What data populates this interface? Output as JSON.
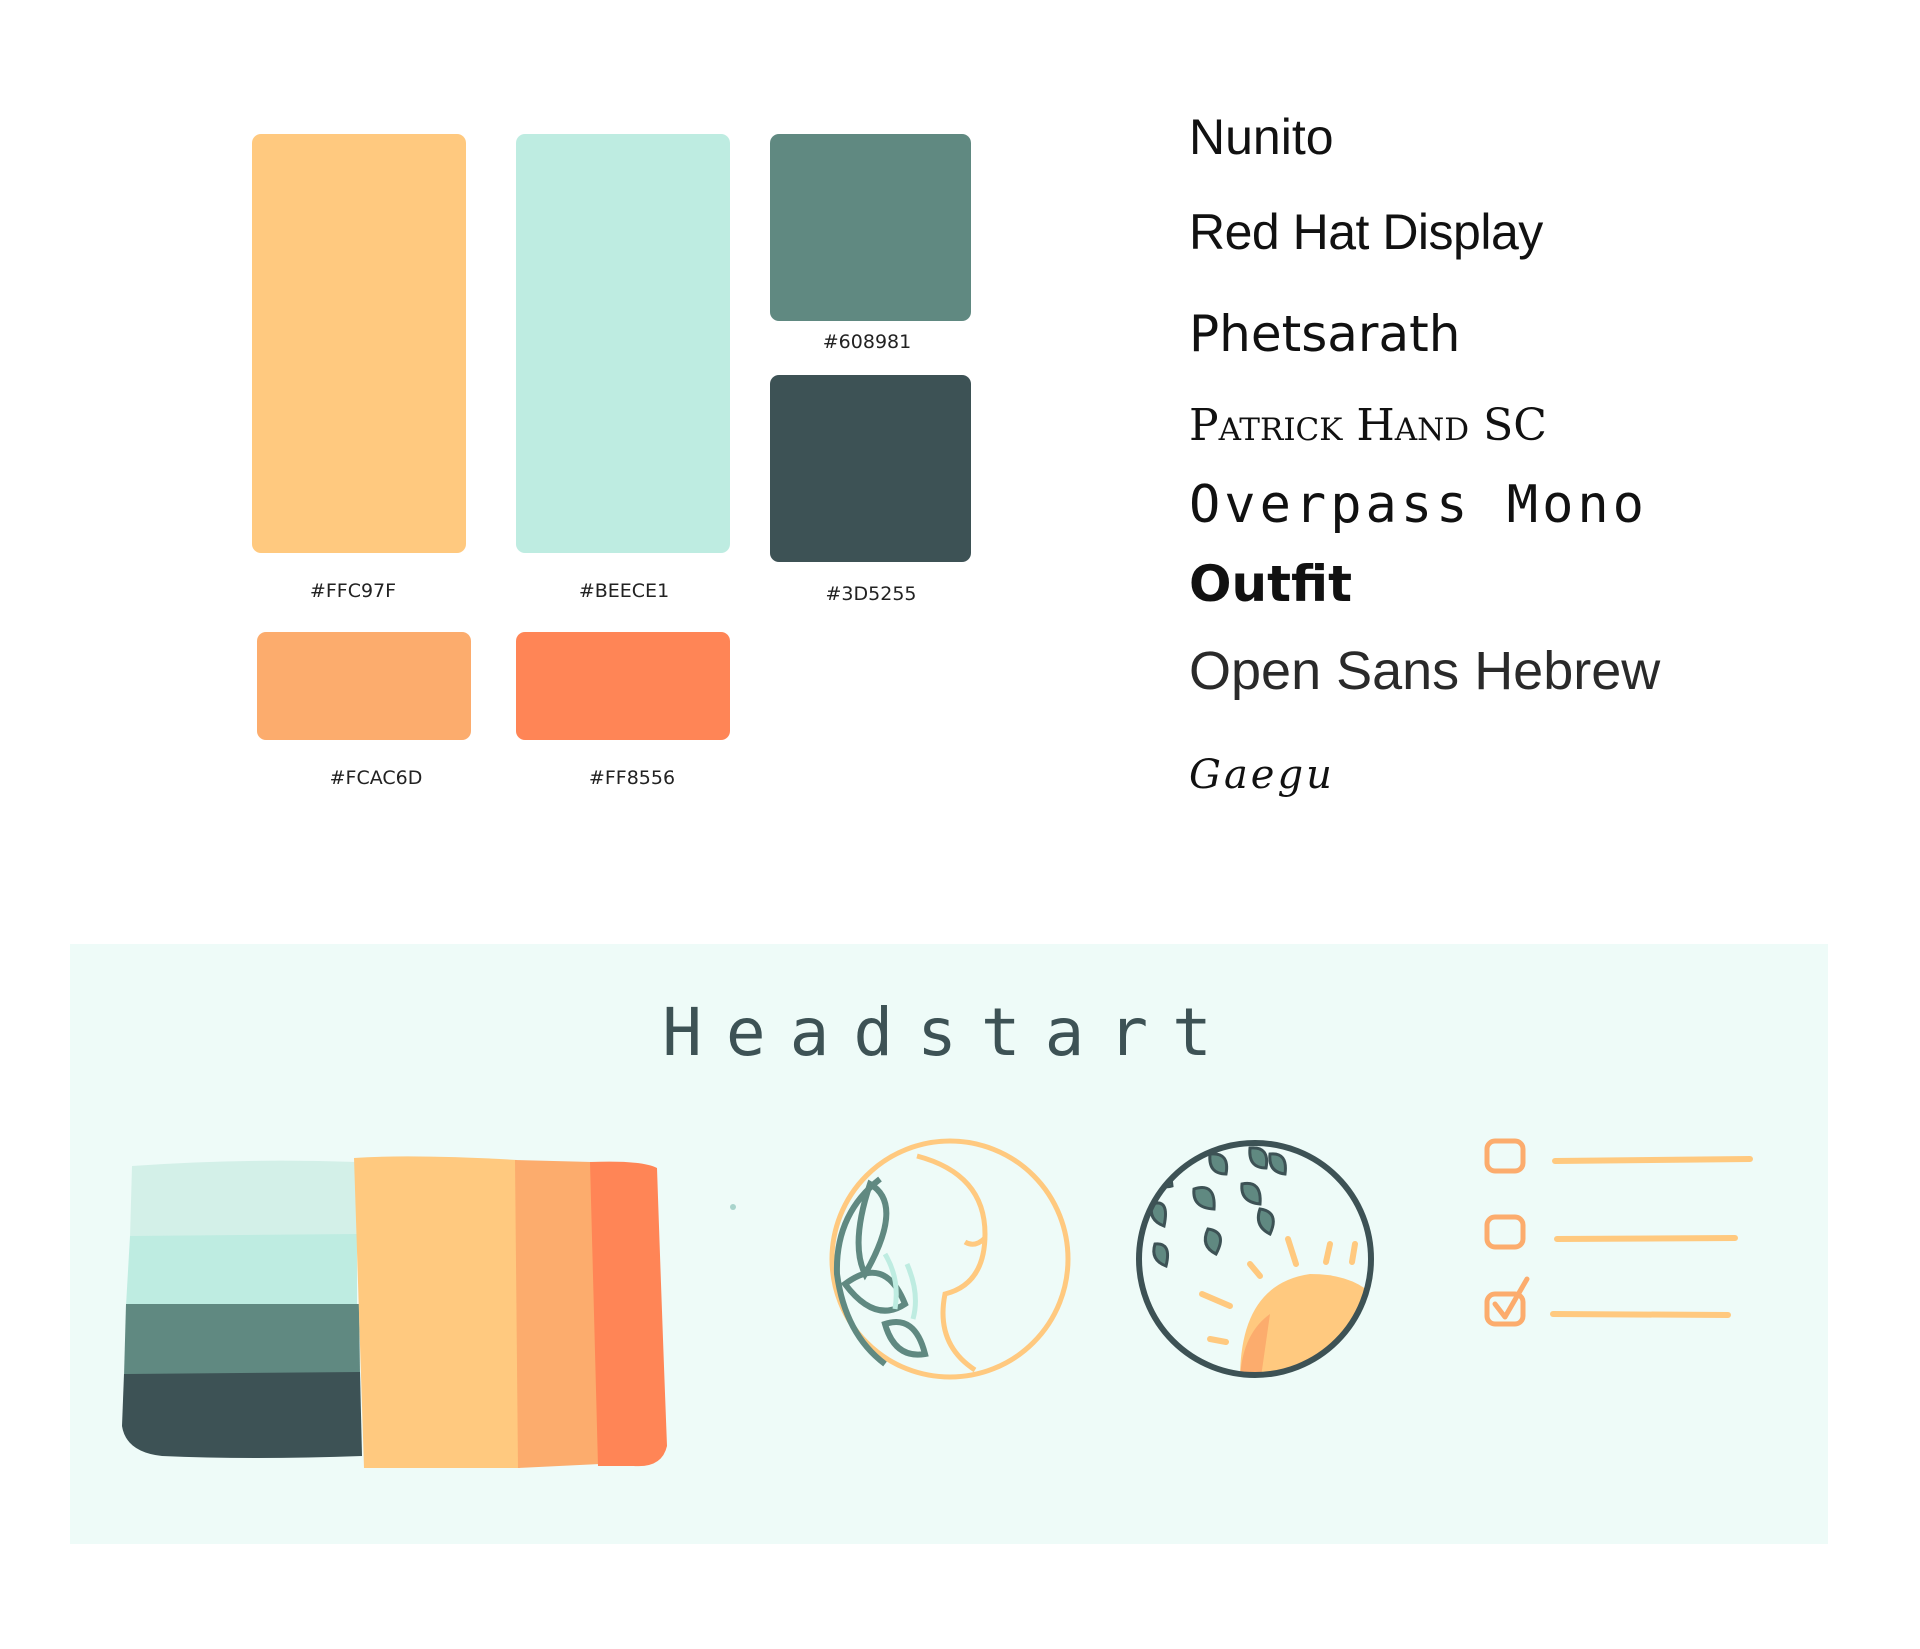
{
  "palette": {
    "swatches": [
      {
        "name": "yellow",
        "hex": "#FFC97F",
        "label": "#FFC97F"
      },
      {
        "name": "mint",
        "hex": "#BEECE1",
        "label": "#BEECE1"
      },
      {
        "name": "sage",
        "hex": "#608981",
        "label": "#608981"
      },
      {
        "name": "slate",
        "hex": "#3D5255",
        "label": "#3D5255"
      },
      {
        "name": "peach",
        "hex": "#FCAC6D",
        "label": "#FCAC6D"
      },
      {
        "name": "coral",
        "hex": "#FF8556",
        "label": "#FF8556"
      }
    ]
  },
  "fonts": {
    "names": [
      "Nunito",
      "Red Hat Display",
      "Phetsarath",
      "Patrick Hand SC",
      "Overpass Mono",
      "Outfit",
      "Open Sans Hebrew",
      "Gaegu"
    ]
  },
  "moodboard": {
    "title": "Headstart",
    "background": "#EEFBF8",
    "icons": [
      "face-moon-plant-icon",
      "sun-leaves-icon",
      "checklist-icon"
    ]
  }
}
